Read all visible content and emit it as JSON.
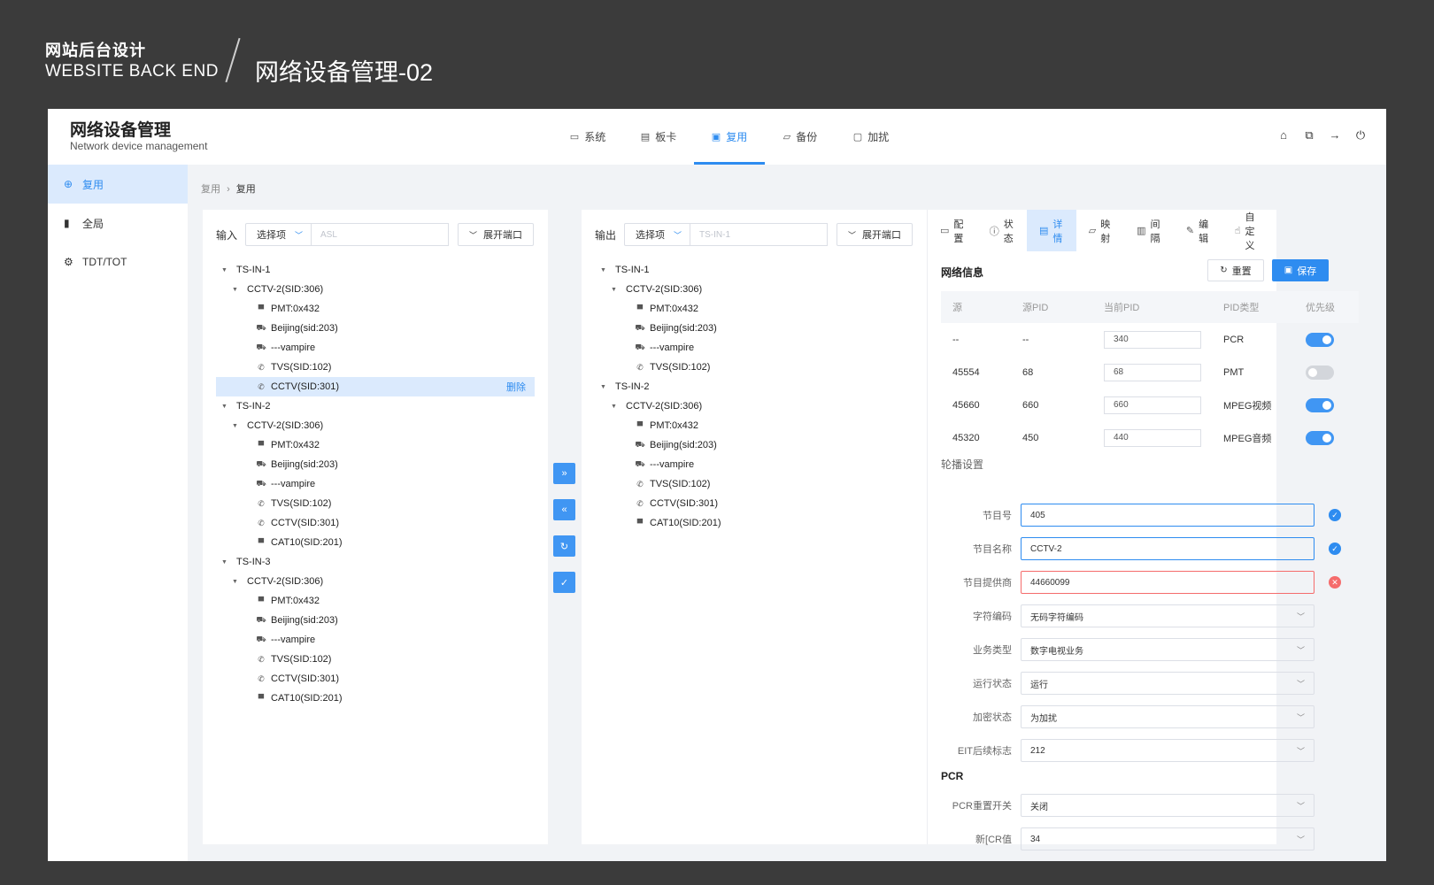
{
  "poster": {
    "title_cn": "网站后台设计",
    "title_en": "WEBSITE BACK END",
    "page_title": "网络设备管理-02"
  },
  "brand": {
    "title": "网络设备管理",
    "subtitle": "Network device management"
  },
  "nav": [
    {
      "label": "系统",
      "icon": "monitor-icon"
    },
    {
      "label": "板卡",
      "icon": "card-icon"
    },
    {
      "label": "复用",
      "icon": "multiplex-icon",
      "active": true
    },
    {
      "label": "备份",
      "icon": "folder-icon"
    },
    {
      "label": "加扰",
      "icon": "box-icon"
    }
  ],
  "sidebar": [
    {
      "label": "复用",
      "icon": "plus-circle-icon",
      "active": true
    },
    {
      "label": "全局",
      "icon": "clipboard-icon"
    },
    {
      "label": "TDT/TOT",
      "icon": "gear-icon"
    }
  ],
  "breadcrumb": {
    "parent": "复用",
    "sep": "›",
    "current": "复用"
  },
  "input_panel": {
    "label": "输入",
    "select": "选择项",
    "field_placeholder": "ASL",
    "expand": "展开端口",
    "tree": [
      {
        "t": "TS-IN-1",
        "lv": 0
      },
      {
        "t": "CCTV-2(SID:306)",
        "lv": 1
      },
      {
        "t": "PMT:0x432",
        "lv": 2,
        "i": "▀"
      },
      {
        "t": "Beijing(sid:203)",
        "lv": 2,
        "i": "⛟"
      },
      {
        "t": "---vampire",
        "lv": 2,
        "i": "⛟"
      },
      {
        "t": "TVS(SID:102)",
        "lv": 2,
        "i": "✆"
      },
      {
        "t": "CCTV(SID:301)",
        "lv": 2,
        "i": "✆",
        "selected": true,
        "action": "删除"
      },
      {
        "t": "TS-IN-2",
        "lv": 0
      },
      {
        "t": "CCTV-2(SID:306)",
        "lv": 1
      },
      {
        "t": "PMT:0x432",
        "lv": 2,
        "i": "▀"
      },
      {
        "t": "Beijing(sid:203)",
        "lv": 2,
        "i": "⛟"
      },
      {
        "t": "---vampire",
        "lv": 2,
        "i": "⛟"
      },
      {
        "t": "TVS(SID:102)",
        "lv": 2,
        "i": "✆"
      },
      {
        "t": "CCTV(SID:301)",
        "lv": 2,
        "i": "✆"
      },
      {
        "t": "CAT10(SID:201)",
        "lv": 2,
        "i": "▀"
      },
      {
        "t": "TS-IN-3",
        "lv": 0
      },
      {
        "t": "CCTV-2(SID:306)",
        "lv": 1
      },
      {
        "t": "PMT:0x432",
        "lv": 2,
        "i": "▀"
      },
      {
        "t": "Beijing(sid:203)",
        "lv": 2,
        "i": "⛟"
      },
      {
        "t": "---vampire",
        "lv": 2,
        "i": "⛟"
      },
      {
        "t": "TVS(SID:102)",
        "lv": 2,
        "i": "✆"
      },
      {
        "t": "CCTV(SID:301)",
        "lv": 2,
        "i": "✆"
      },
      {
        "t": "CAT10(SID:201)",
        "lv": 2,
        "i": "▀"
      }
    ]
  },
  "mid_buttons": [
    "»",
    "«",
    "↻",
    "✓"
  ],
  "output_panel": {
    "label": "输出",
    "select": "选择项",
    "field_placeholder": "TS-IN-1",
    "expand": "展开端口",
    "tree": [
      {
        "t": "TS-IN-1",
        "lv": 0
      },
      {
        "t": "CCTV-2(SID:306)",
        "lv": 1
      },
      {
        "t": "PMT:0x432",
        "lv": 2,
        "i": "▀"
      },
      {
        "t": "Beijing(sid:203)",
        "lv": 2,
        "i": "⛟"
      },
      {
        "t": "---vampire",
        "lv": 2,
        "i": "⛟"
      },
      {
        "t": "TVS(SID:102)",
        "lv": 2,
        "i": "✆"
      },
      {
        "t": "TS-IN-2",
        "lv": 0
      },
      {
        "t": "CCTV-2(SID:306)",
        "lv": 1
      },
      {
        "t": "PMT:0x432",
        "lv": 2,
        "i": "▀"
      },
      {
        "t": "Beijing(sid:203)",
        "lv": 2,
        "i": "⛟"
      },
      {
        "t": "---vampire",
        "lv": 2,
        "i": "⛟"
      },
      {
        "t": "TVS(SID:102)",
        "lv": 2,
        "i": "✆"
      },
      {
        "t": "CCTV(SID:301)",
        "lv": 2,
        "i": "✆"
      },
      {
        "t": "CAT10(SID:201)",
        "lv": 2,
        "i": "▀"
      }
    ]
  },
  "detail_tabs": [
    {
      "label": "配置",
      "icon": "monitor-icon"
    },
    {
      "label": "状态",
      "icon": "info-icon"
    },
    {
      "label": "详情",
      "icon": "document-icon",
      "active": true
    },
    {
      "label": "映射",
      "icon": "folder-icon"
    },
    {
      "label": "间隔",
      "icon": "interval-icon"
    },
    {
      "label": "编辑",
      "icon": "edit-icon"
    },
    {
      "label": "自定义",
      "icon": "custom-icon"
    }
  ],
  "network_info": {
    "title": "网络信息",
    "reset": "重置",
    "save": "保存",
    "columns": [
      "源",
      "源PID",
      "当前PID",
      "PID类型",
      "优先级"
    ],
    "rows": [
      {
        "src": "--",
        "src_pid": "--",
        "cur_pid": "340",
        "type": "PCR",
        "priority": true
      },
      {
        "src": "45554",
        "src_pid": "68",
        "cur_pid": "68",
        "type": "PMT",
        "priority": false
      },
      {
        "src": "45660",
        "src_pid": "660",
        "cur_pid": "660",
        "type": "MPEG视频",
        "priority": true
      },
      {
        "src": "45320",
        "src_pid": "450",
        "cur_pid": "440",
        "type": "MPEG音频",
        "priority": true
      }
    ]
  },
  "carousel": {
    "title": "轮播设置",
    "fields": [
      {
        "label": "节目号",
        "value": "405",
        "kind": "text",
        "status": "ok"
      },
      {
        "label": "节目名称",
        "value": "CCTV-2",
        "kind": "text",
        "status": "ok"
      },
      {
        "label": "节目提供商",
        "value": "44660099",
        "kind": "text",
        "status": "error"
      },
      {
        "label": "字符编码",
        "value": "无码字符编码",
        "kind": "select"
      },
      {
        "label": "业务类型",
        "value": "数字电视业务",
        "kind": "select"
      },
      {
        "label": "运行状态",
        "value": "运行",
        "kind": "select"
      },
      {
        "label": "加密状态",
        "value": "为加扰",
        "kind": "select"
      },
      {
        "label": "EIT后续标志",
        "value": "212",
        "kind": "select"
      }
    ]
  },
  "pcr": {
    "title": "PCR",
    "fields": [
      {
        "label": "PCR重置开关",
        "value": "关闭",
        "kind": "select"
      },
      {
        "label": "新[CR值",
        "value": "34",
        "kind": "select"
      }
    ]
  },
  "colors": {
    "accent": "#2e8cf0",
    "error": "#f56c6c",
    "selected_bg": "#dbeafd"
  }
}
